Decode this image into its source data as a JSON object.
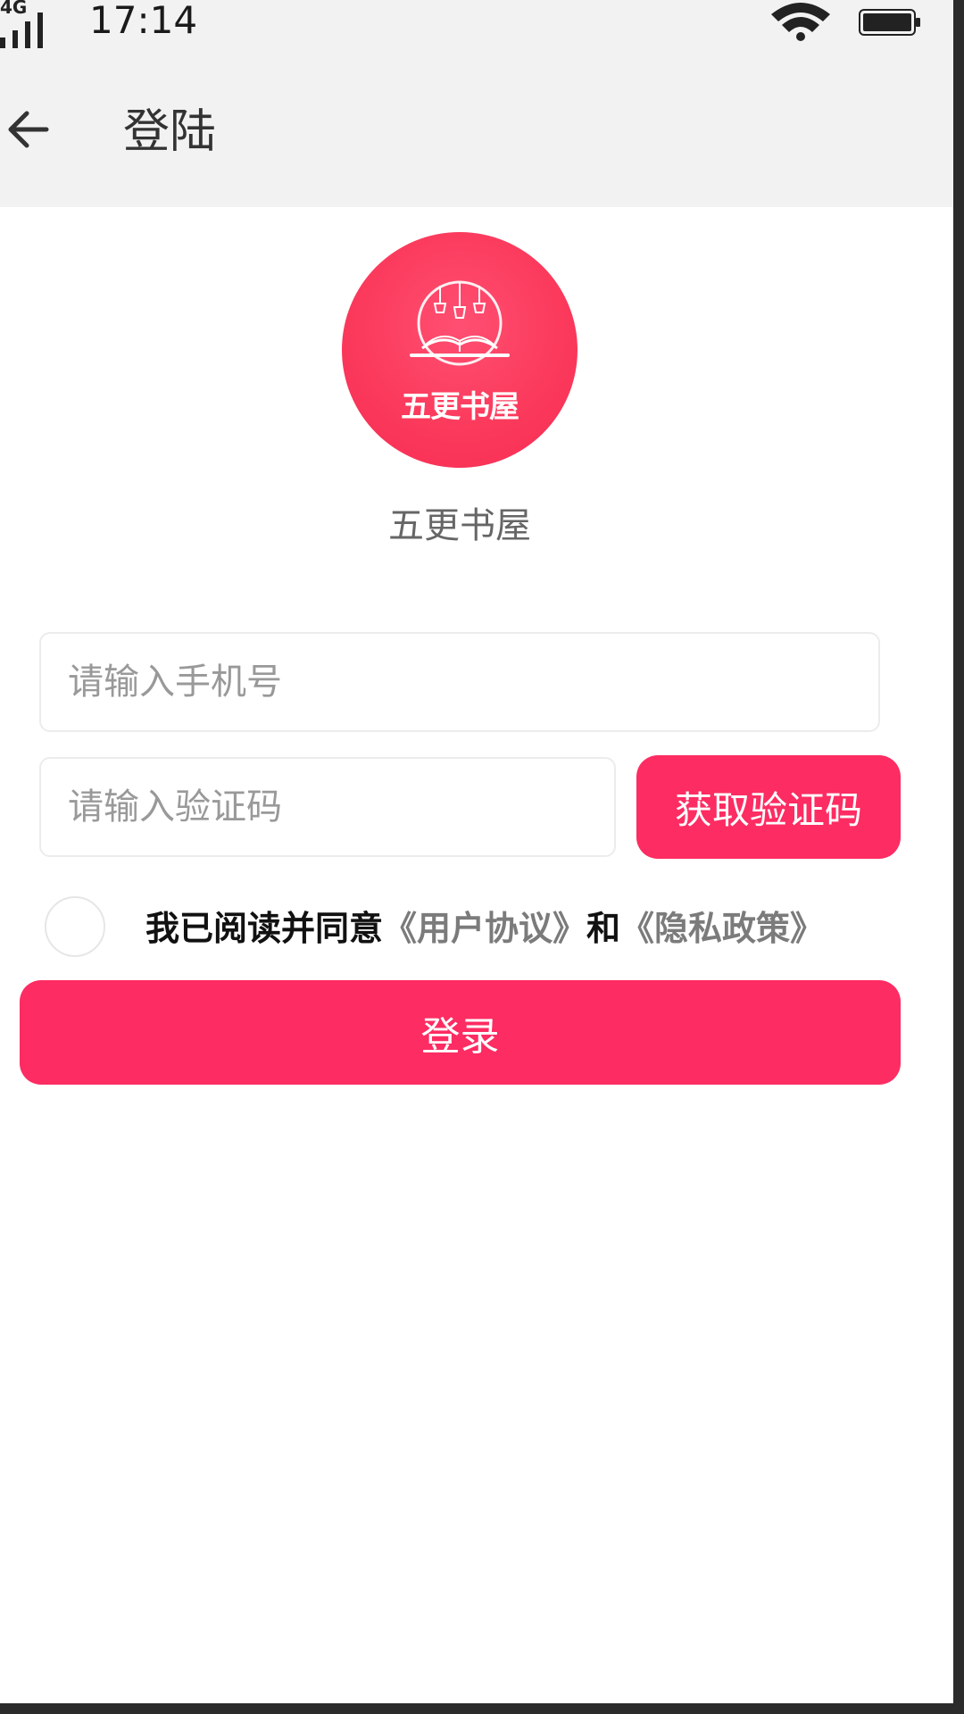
{
  "status_bar": {
    "network_type": "4G",
    "time": "17:14",
    "icons": [
      "signal-icon",
      "wifi-icon",
      "battery-icon"
    ]
  },
  "header": {
    "back_icon": "back-arrow-icon",
    "title": "登陆"
  },
  "app": {
    "logo_text": "五更书屋",
    "name": "五更书屋"
  },
  "form": {
    "phone_placeholder": "请输入手机号",
    "phone_value": "",
    "code_placeholder": "请输入验证码",
    "code_value": "",
    "get_code_label": "获取验证码",
    "agree_checked": false,
    "agree_prefix": "我已阅读并同意",
    "user_agreement": "《用户协议》",
    "agree_and": "和",
    "privacy_policy": "《隐私政策》",
    "login_label": "登录"
  },
  "colors": {
    "accent": "#fd2c62",
    "nav_background": "#f2f2f2",
    "placeholder": "#999999",
    "link": "#7b7b7b"
  }
}
